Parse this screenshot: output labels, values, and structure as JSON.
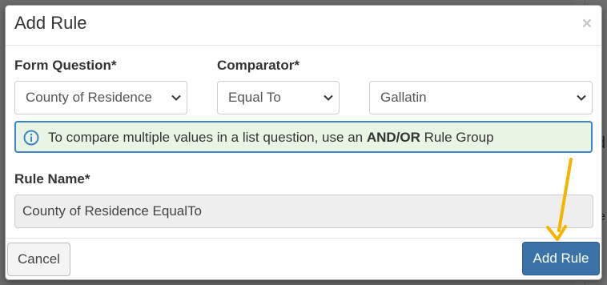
{
  "background": {
    "peek_texts": [
      "d",
      "e"
    ]
  },
  "modal": {
    "title": "Add Rule",
    "close_symbol": "×",
    "form_question": {
      "label": "Form Question*",
      "selected": "County of Residence"
    },
    "comparator": {
      "label": "Comparator*",
      "selected": "Equal To"
    },
    "value_select": {
      "selected": "Gallatin"
    },
    "info": {
      "text_before": "To compare multiple values in a list question, use an ",
      "bold": "AND/OR",
      "text_after": " Rule Group",
      "icon": "info-circle-icon"
    },
    "rule_name": {
      "label": "Rule Name*",
      "value": "County of Residence EqualTo"
    },
    "cancel_label": "Cancel",
    "add_label": "Add Rule"
  },
  "annotation": {
    "arrow_color": "#f5b400"
  },
  "colors": {
    "info_border": "#3d85c6",
    "info_bg": "#e9f5e4",
    "primary_button": "#3a73a8"
  }
}
